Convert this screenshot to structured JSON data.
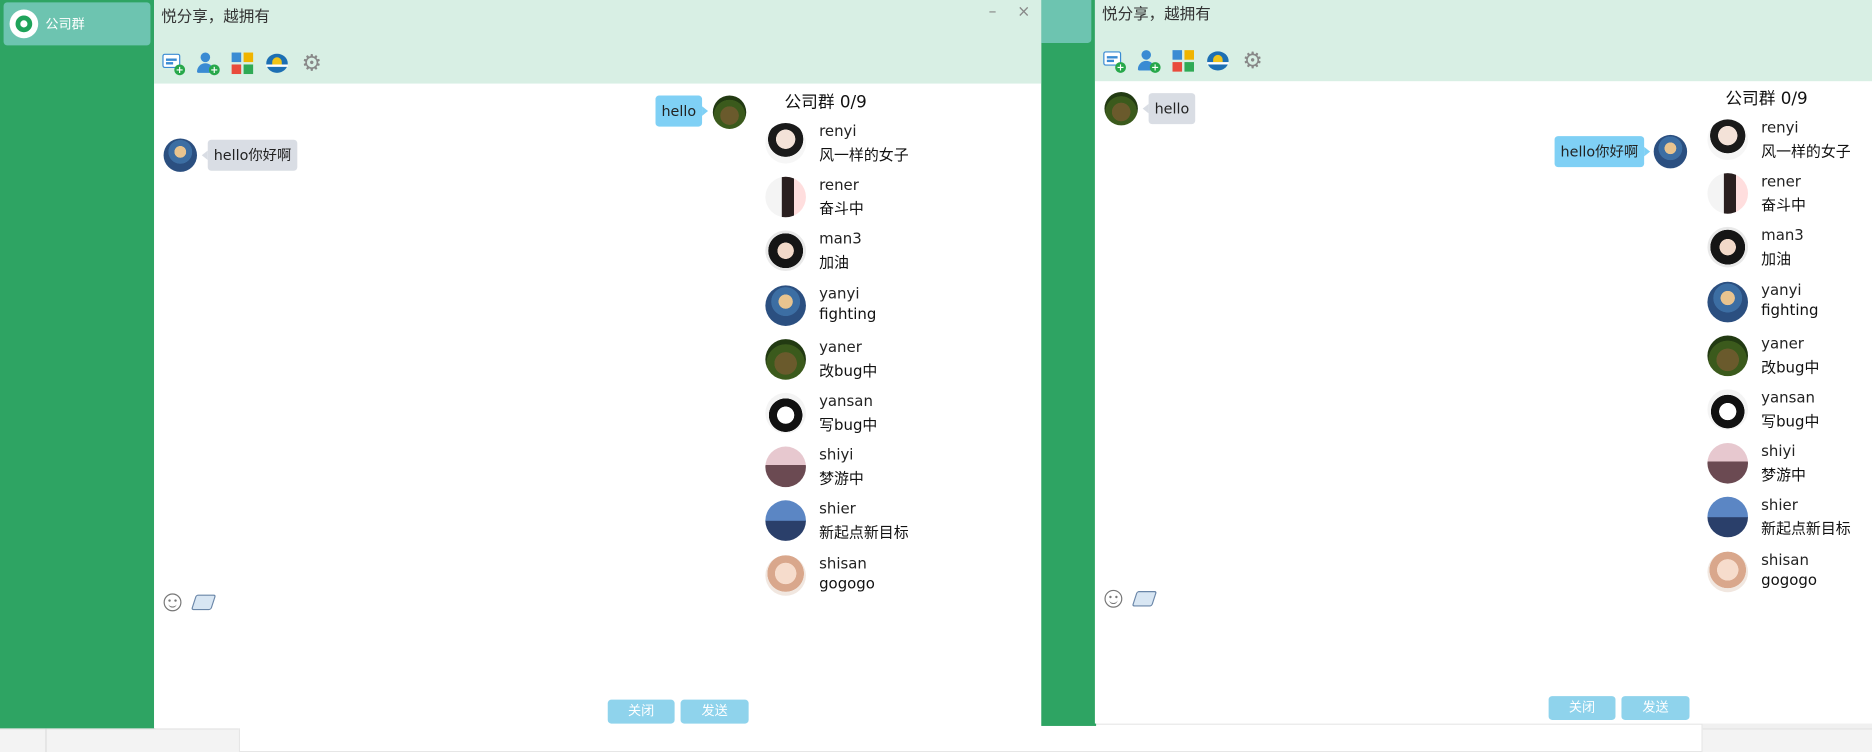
{
  "sidebar": {
    "item_label": "公司群"
  },
  "window_left": {
    "title": "悦分享，越拥有",
    "minimize": "–",
    "close": "×",
    "messages": [
      {
        "from": "me",
        "text": "hello"
      },
      {
        "from": "other",
        "text": "hello你好啊"
      }
    ],
    "members_title": "公司群 0/9",
    "buttons": {
      "close": "关闭",
      "send": "发送"
    }
  },
  "window_right": {
    "title": "悦分享，越拥有",
    "messages": [
      {
        "from": "other",
        "text": "hello"
      },
      {
        "from": "me",
        "text": "hello你好啊"
      }
    ],
    "members_title": "公司群 0/9",
    "buttons": {
      "close": "关闭",
      "send": "发送"
    }
  },
  "members": [
    {
      "name": "renyi",
      "signature": "风一样的女子"
    },
    {
      "name": "rener",
      "signature": "奋斗中"
    },
    {
      "name": "man3",
      "signature": "加油"
    },
    {
      "name": "yanyi",
      "signature": "fighting"
    },
    {
      "name": "yaner",
      "signature": "改bug中"
    },
    {
      "name": "yansan",
      "signature": "写bug中"
    },
    {
      "name": "shiyi",
      "signature": "梦游中"
    },
    {
      "name": "shier",
      "signature": "新起点新目标"
    },
    {
      "name": "shisan",
      "signature": "gogogo"
    }
  ],
  "icons": {
    "toolbar": [
      "new-chat-icon",
      "add-user-icon",
      "apps-grid-icon",
      "cap-icon",
      "gear-icon"
    ],
    "input": [
      "emoji-icon",
      "folder-icon"
    ]
  },
  "colors": {
    "sidebar_green": "#2ea463",
    "header_bg": "#d8efe4",
    "bubble_me": "#7fd0f5",
    "bubble_other": "#d9dde4",
    "button_bg": "#8fd3ec"
  }
}
